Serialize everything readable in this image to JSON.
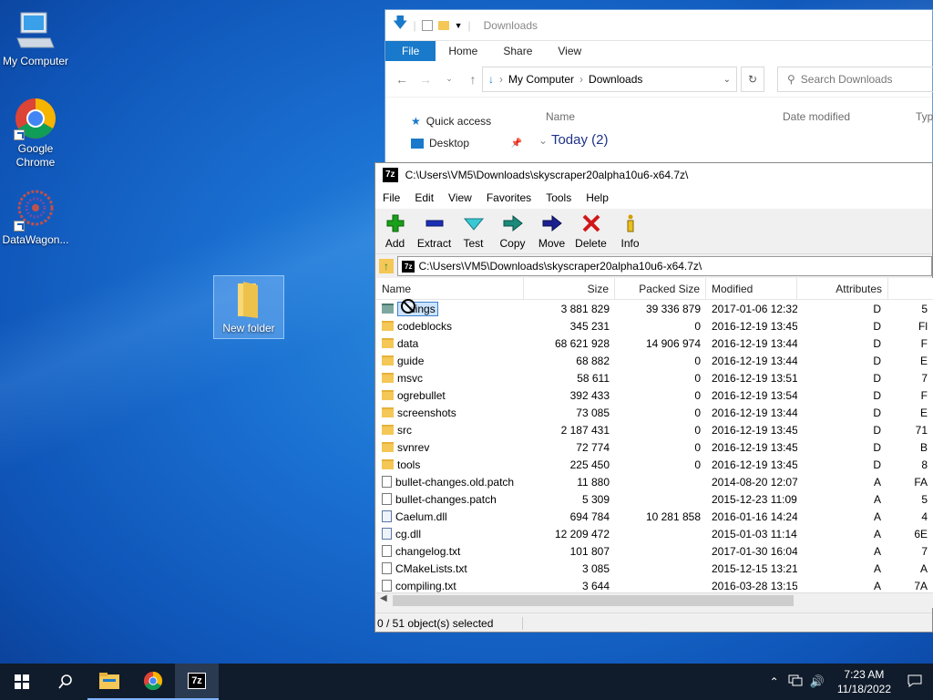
{
  "desktop": {
    "icons": [
      {
        "label": "My Computer"
      },
      {
        "label": "Google\nChrome"
      },
      {
        "label": "DataWagon..."
      },
      {
        "label": "New folder"
      }
    ]
  },
  "explorer": {
    "title": "Downloads",
    "ribbon_tabs": [
      "File",
      "Home",
      "Share",
      "View"
    ],
    "breadcrumb": [
      "My Computer",
      "Downloads"
    ],
    "search_placeholder": "Search Downloads",
    "nav_items": [
      "Quick access",
      "Desktop"
    ],
    "columns": [
      "Name",
      "Date modified",
      "Typ"
    ],
    "group_label": "Today (2)"
  },
  "sevenzip": {
    "title": "C:\\Users\\VM5\\Downloads\\skyscraper20alpha10u6-x64.7z\\",
    "menu": [
      "File",
      "Edit",
      "View",
      "Favorites",
      "Tools",
      "Help"
    ],
    "toolbar": [
      {
        "label": "Add",
        "icon": "plus-icon",
        "color": "#1aa01a"
      },
      {
        "label": "Extract",
        "icon": "minus-icon",
        "color": "#1a2fb4"
      },
      {
        "label": "Test",
        "icon": "check-icon",
        "color": "#1aa8b4"
      },
      {
        "label": "Copy",
        "icon": "copy-arrow-icon",
        "color": "#1a8a7a"
      },
      {
        "label": "Move",
        "icon": "move-arrow-icon",
        "color": "#1a2090"
      },
      {
        "label": "Delete",
        "icon": "x-icon",
        "color": "#d01818"
      },
      {
        "label": "Info",
        "icon": "info-icon",
        "color": "#d0a000"
      }
    ],
    "path": "C:\\Users\\VM5\\Downloads\\skyscraper20alpha10u6-x64.7z\\",
    "columns": [
      "Name",
      "Size",
      "Packed Size",
      "Modified",
      "Attributes"
    ],
    "rows": [
      {
        "name": "dings",
        "size": "3 881 829",
        "packed": "39 336 879",
        "modified": "2017-01-06 12:32",
        "attr": "D",
        "extra": "5",
        "type": "folder",
        "selected": true
      },
      {
        "name": "codeblocks",
        "size": "345 231",
        "packed": "0",
        "modified": "2016-12-19 13:45",
        "attr": "D",
        "extra": "Fl",
        "type": "folder"
      },
      {
        "name": "data",
        "size": "68 621 928",
        "packed": "14 906 974",
        "modified": "2016-12-19 13:44",
        "attr": "D",
        "extra": "F",
        "type": "folder"
      },
      {
        "name": "guide",
        "size": "68 882",
        "packed": "0",
        "modified": "2016-12-19 13:44",
        "attr": "D",
        "extra": "E",
        "type": "folder"
      },
      {
        "name": "msvc",
        "size": "58 611",
        "packed": "0",
        "modified": "2016-12-19 13:51",
        "attr": "D",
        "extra": "7",
        "type": "folder"
      },
      {
        "name": "ogrebullet",
        "size": "392 433",
        "packed": "0",
        "modified": "2016-12-19 13:54",
        "attr": "D",
        "extra": "F",
        "type": "folder"
      },
      {
        "name": "screenshots",
        "size": "73 085",
        "packed": "0",
        "modified": "2016-12-19 13:44",
        "attr": "D",
        "extra": "E",
        "type": "folder"
      },
      {
        "name": "src",
        "size": "2 187 431",
        "packed": "0",
        "modified": "2016-12-19 13:45",
        "attr": "D",
        "extra": "71",
        "type": "folder"
      },
      {
        "name": "svnrev",
        "size": "72 774",
        "packed": "0",
        "modified": "2016-12-19 13:45",
        "attr": "D",
        "extra": "B",
        "type": "folder"
      },
      {
        "name": "tools",
        "size": "225 450",
        "packed": "0",
        "modified": "2016-12-19 13:45",
        "attr": "D",
        "extra": "8",
        "type": "folder"
      },
      {
        "name": "bullet-changes.old.patch",
        "size": "11 880",
        "packed": "",
        "modified": "2014-08-20 12:07",
        "attr": "A",
        "extra": "FA",
        "type": "file"
      },
      {
        "name": "bullet-changes.patch",
        "size": "5 309",
        "packed": "",
        "modified": "2015-12-23 11:09",
        "attr": "A",
        "extra": "5",
        "type": "file"
      },
      {
        "name": "Caelum.dll",
        "size": "694 784",
        "packed": "10 281 858",
        "modified": "2016-01-16 14:24",
        "attr": "A",
        "extra": "4",
        "type": "dll"
      },
      {
        "name": "cg.dll",
        "size": "12 209 472",
        "packed": "",
        "modified": "2015-01-03 11:14",
        "attr": "A",
        "extra": "6E",
        "type": "dll"
      },
      {
        "name": "changelog.txt",
        "size": "101 807",
        "packed": "",
        "modified": "2017-01-30 16:04",
        "attr": "A",
        "extra": "7",
        "type": "file"
      },
      {
        "name": "CMakeLists.txt",
        "size": "3 085",
        "packed": "",
        "modified": "2015-12-15 13:21",
        "attr": "A",
        "extra": "A",
        "type": "file"
      },
      {
        "name": "compiling.txt",
        "size": "3 644",
        "packed": "",
        "modified": "2016-03-28 13:15",
        "attr": "A",
        "extra": "7A",
        "type": "file"
      }
    ],
    "status": "0 / 51 object(s) selected"
  },
  "taskbar": {
    "time": "7:23 AM",
    "date": "11/18/2022",
    "apps": [
      "start-icon",
      "search-icon",
      "file-explorer-icon",
      "chrome-icon",
      "7zip-icon"
    ]
  }
}
